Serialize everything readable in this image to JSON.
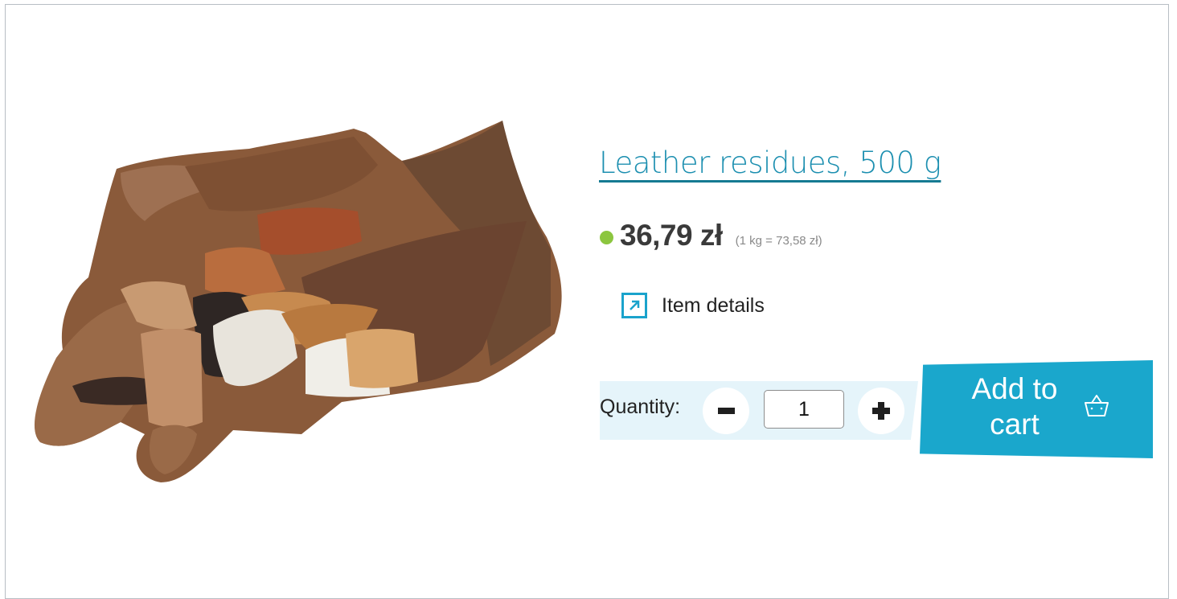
{
  "product": {
    "title": "Leather residues, 500 g",
    "price": "36,79 zł",
    "unit_price": "(1 kg = 73,58 zł)",
    "availability_color": "#8cc63f",
    "image_icon": "leather-scraps-image"
  },
  "details_link": {
    "label": "Item details",
    "icon": "external-arrow-icon"
  },
  "quantity": {
    "label": "Quantity:",
    "value": "1",
    "decrease_icon": "minus-icon",
    "increase_icon": "plus-icon"
  },
  "cart_button": {
    "label": "Add to cart",
    "icon": "basket-icon"
  },
  "colors": {
    "accent": "#1aa7cc",
    "title": "#1c8fb0",
    "band": "#e5f4fa"
  }
}
